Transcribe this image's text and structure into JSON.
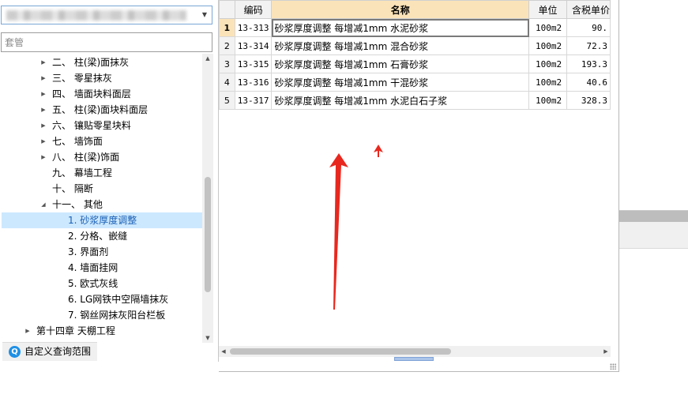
{
  "left_panel": {
    "filter_input": {
      "placeholder": "套管",
      "value": ""
    },
    "tree": [
      {
        "label": "二、 柱(梁)面抹灰",
        "level": 1,
        "expandable": true
      },
      {
        "label": "三、 零星抹灰",
        "level": 1,
        "expandable": true
      },
      {
        "label": "四、 墙面块料面层",
        "level": 1,
        "expandable": true
      },
      {
        "label": "五、 柱(梁)面块料面层",
        "level": 1,
        "expandable": true
      },
      {
        "label": "六、 镶贴零星块料",
        "level": 1,
        "expandable": true
      },
      {
        "label": "七、 墙饰面",
        "level": 1,
        "expandable": true
      },
      {
        "label": "八、 柱(梁)饰面",
        "level": 1,
        "expandable": true
      },
      {
        "label": "九、 幕墙工程",
        "level": 1,
        "expandable": false
      },
      {
        "label": "十、 隔断",
        "level": 1,
        "expandable": false
      },
      {
        "label": "十一、 其他",
        "level": 1,
        "expandable": true,
        "expanded": true
      },
      {
        "label": "1. 砂浆厚度调整",
        "level": 2,
        "selected": true
      },
      {
        "label": "2. 分格、嵌缝",
        "level": 2
      },
      {
        "label": "3. 界面剂",
        "level": 2
      },
      {
        "label": "4. 墙面挂网",
        "level": 2
      },
      {
        "label": "5. 欧式灰线",
        "level": 2
      },
      {
        "label": "6. LG网铁中空隔墙抹灰",
        "level": 2
      },
      {
        "label": "7. 钢丝网抹灰阳台栏板",
        "level": 2
      },
      {
        "label": "第十四章 天棚工程",
        "level": 0,
        "expandable": true
      }
    ],
    "custom_scope_label": "自定义查询范围"
  },
  "grid": {
    "columns": [
      "",
      "编码",
      "名称",
      "单位",
      "含税单价"
    ],
    "active_column": "名称",
    "rows": [
      {
        "num": "1",
        "code": "13-313",
        "name": "砂浆厚度调整 每增减1mm 水泥砂浆",
        "unit": "100m2",
        "price": "90."
      },
      {
        "num": "2",
        "code": "13-314",
        "name": "砂浆厚度调整 每增减1mm 混合砂浆",
        "unit": "100m2",
        "price": "72.3"
      },
      {
        "num": "3",
        "code": "13-315",
        "name": "砂浆厚度调整 每增减1mm 石膏砂浆",
        "unit": "100m2",
        "price": "193.3"
      },
      {
        "num": "4",
        "code": "13-316",
        "name": "砂浆厚度调整 每增减1mm 干混砂浆",
        "unit": "100m2",
        "price": "40.6"
      },
      {
        "num": "5",
        "code": "13-317",
        "name": "砂浆厚度调整 每增减1mm 水泥白石子浆",
        "unit": "100m2",
        "price": "328.3"
      }
    ],
    "current_row": 0
  },
  "icons": {
    "combo_arrow": "chevron-down-icon",
    "search_scope": "search-icon",
    "annotation": "red-arrow-icon"
  },
  "colors": {
    "selection": "#cce8ff",
    "header_active": "#fbe3b9",
    "annotation_red": "#e8281e"
  }
}
